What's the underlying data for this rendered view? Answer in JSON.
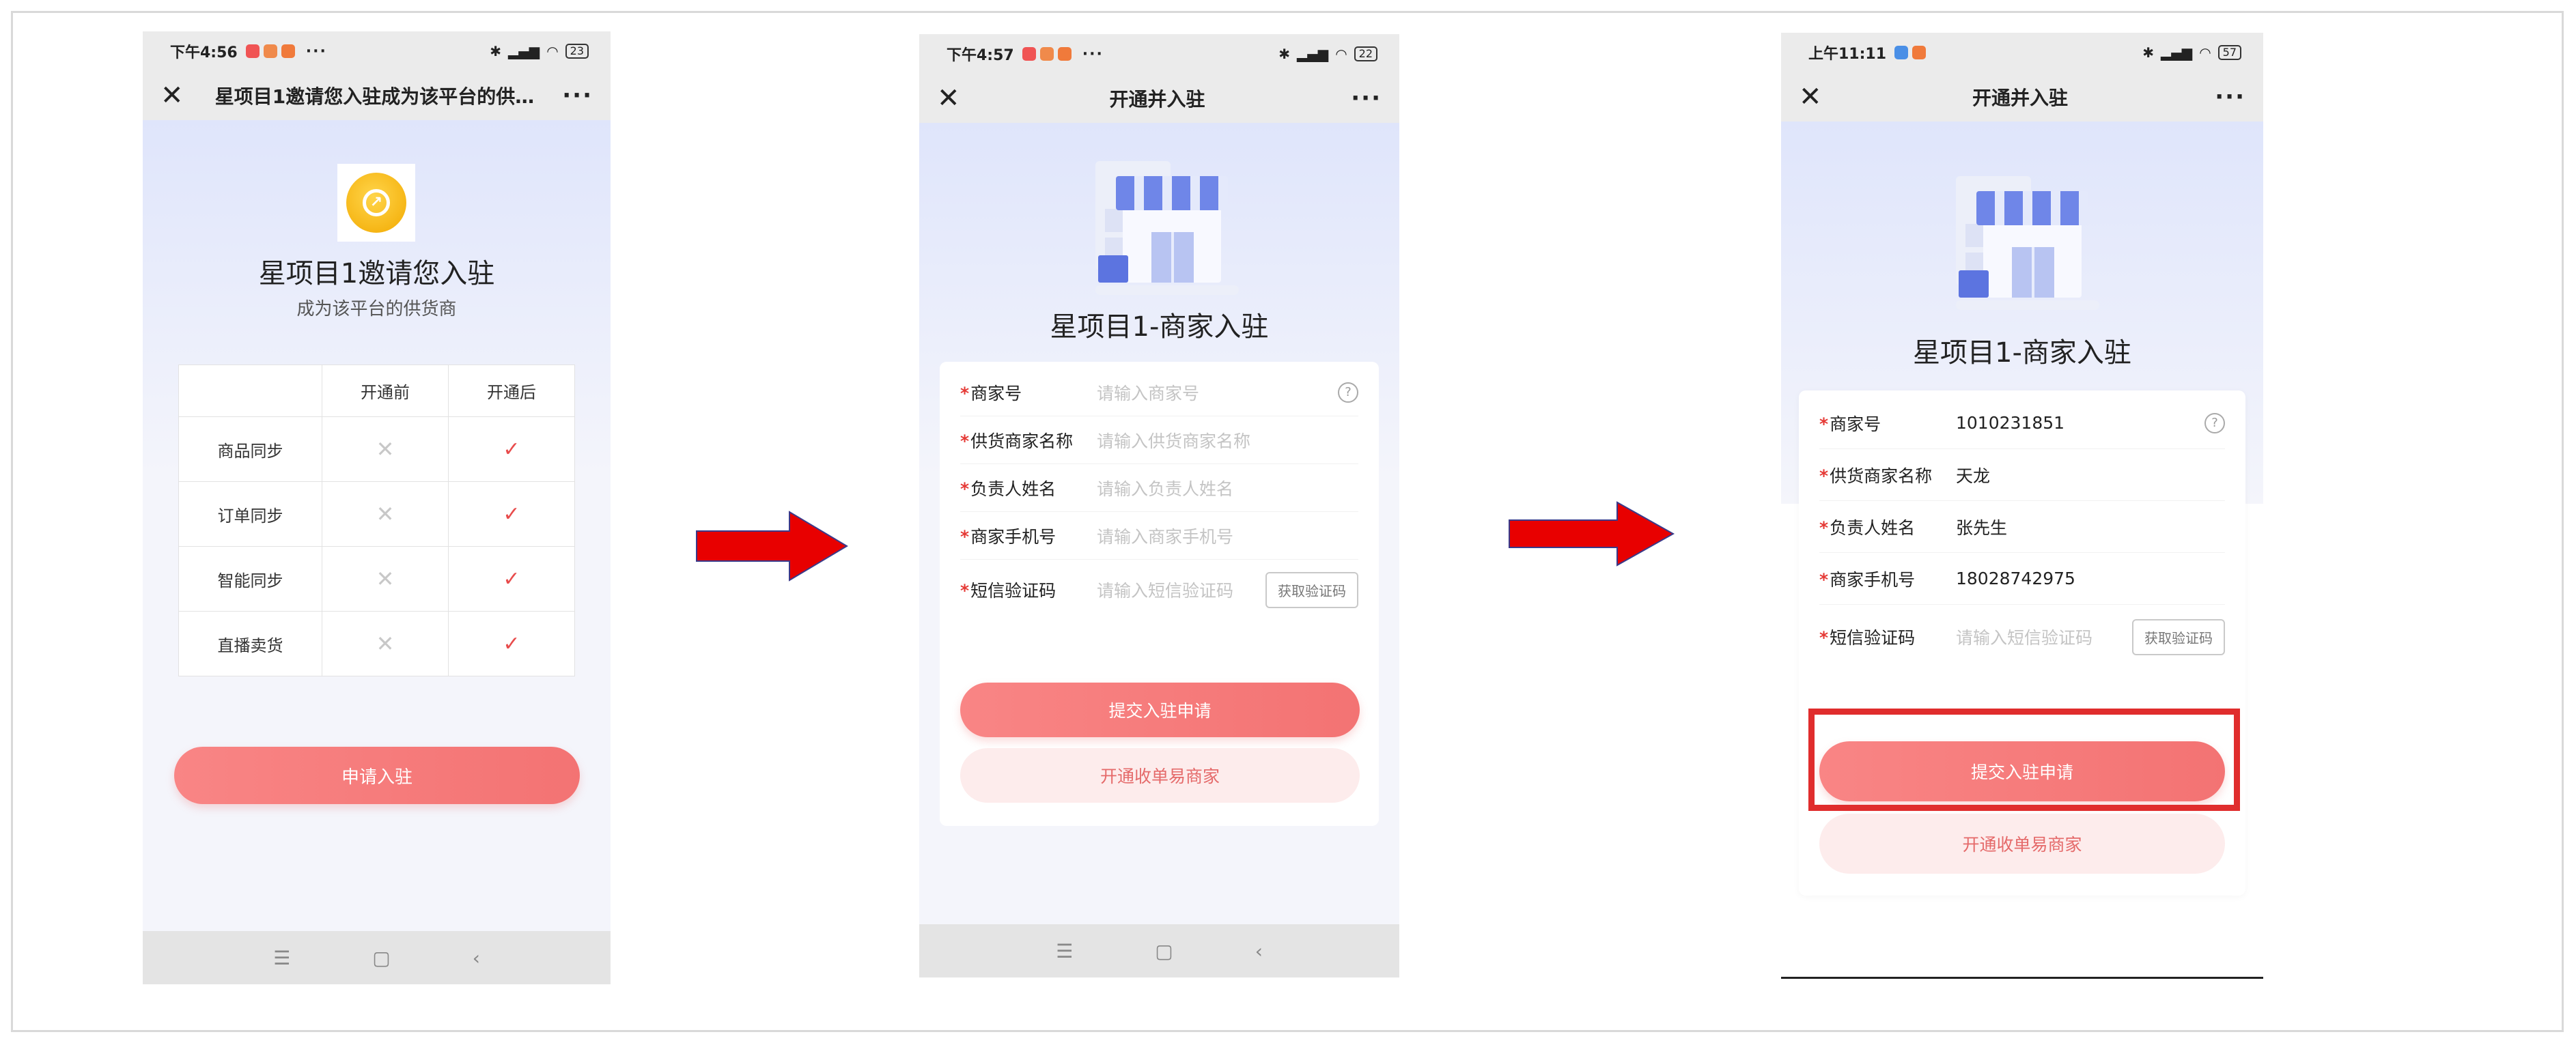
{
  "phone1": {
    "status": {
      "time": "下午4:56",
      "battery": "23"
    },
    "title": "星项目1邀请您入驻成为该平台的供…",
    "heading": "星项目1邀请您入驻",
    "subheading": "成为该平台的供货商",
    "table": {
      "headers": [
        "",
        "开通前",
        "开通后"
      ],
      "rows": [
        {
          "feature": "商品同步",
          "before": "✕",
          "after": "✓"
        },
        {
          "feature": "订单同步",
          "before": "✕",
          "after": "✓"
        },
        {
          "feature": "智能同步",
          "before": "✕",
          "after": "✓"
        },
        {
          "feature": "直播卖货",
          "before": "✕",
          "after": "✓"
        }
      ]
    },
    "apply_button": "申请入驻"
  },
  "phone2": {
    "status": {
      "time": "下午4:57",
      "battery": "22"
    },
    "title": "开通并入驻",
    "heading": "星项目1-商家入驻",
    "fields": [
      {
        "label": "商家号",
        "placeholder": "请输入商家号"
      },
      {
        "label": "供货商家名称",
        "placeholder": "请输入供货商家名称"
      },
      {
        "label": "负责人姓名",
        "placeholder": "请输入负责人姓名"
      },
      {
        "label": "商家手机号",
        "placeholder": "请输入商家手机号"
      },
      {
        "label": "短信验证码",
        "placeholder": "请输入短信验证码"
      }
    ],
    "get_code": "获取验证码",
    "submit": "提交入驻申请",
    "secondary": "开通收单易商家"
  },
  "phone3": {
    "status": {
      "time": "上午11:11",
      "battery": "57"
    },
    "title": "开通并入驻",
    "heading": "星项目1-商家入驻",
    "fields": [
      {
        "label": "商家号",
        "value": "1010231851"
      },
      {
        "label": "供货商家名称",
        "value": "天龙"
      },
      {
        "label": "负责人姓名",
        "value": "张先生"
      },
      {
        "label": "商家手机号",
        "value": "18028742975"
      },
      {
        "label": "短信验证码",
        "placeholder": "请输入短信验证码"
      }
    ],
    "get_code": "获取验证码",
    "submit": "提交入驻申请",
    "secondary": "开通收单易商家"
  },
  "icons": {
    "close": "✕",
    "more": "···",
    "help": "?",
    "nav_menu": "☰",
    "nav_home": "▢",
    "nav_back": "‹",
    "arrow": "right-arrow-icon"
  },
  "colors": {
    "accent": "#f37373",
    "required": "#e53935",
    "arrow": "#e80000",
    "highlight": "#e02d2d"
  }
}
